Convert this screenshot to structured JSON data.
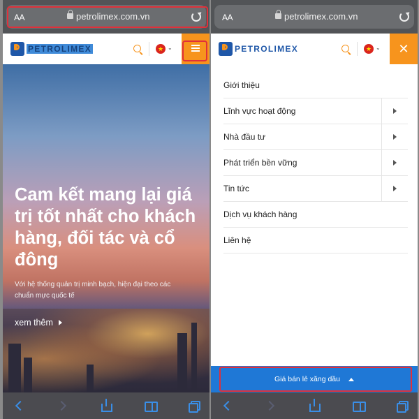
{
  "colors": {
    "brand_blue": "#1f57a8",
    "brand_orange": "#f7941d",
    "link_blue": "#3a8ee6",
    "highlight_red": "#e0303a",
    "price_bar_blue": "#1f78d6"
  },
  "browser": {
    "aa_label": "AA",
    "url": "petrolimex.com.vn"
  },
  "header": {
    "logo_text": "PETROLIMEX",
    "flag_glyph": "★",
    "chevron": "⌄",
    "close_glyph": "✕"
  },
  "hero": {
    "title": "Cam kết mang lại giá trị tốt nhất cho khách hàng, đối tác và cổ đông",
    "subtitle": "Với hệ thống quản trị minh bạch, hiện đại theo các chuẩn mực quốc tế",
    "cta": "xem thêm"
  },
  "menu": {
    "items": [
      {
        "label": "Giới thiệu",
        "has_submenu": false
      },
      {
        "label": "Lĩnh vực hoạt động",
        "has_submenu": true
      },
      {
        "label": "Nhà đầu tư",
        "has_submenu": true
      },
      {
        "label": "Phát triển bền vững",
        "has_submenu": true
      },
      {
        "label": "Tin tức",
        "has_submenu": true
      },
      {
        "label": "Dịch vụ khách hàng",
        "has_submenu": false
      },
      {
        "label": "Liên hệ",
        "has_submenu": false
      }
    ]
  },
  "price_bar": {
    "label": "Giá bán lẻ xăng dầu"
  },
  "toolbar_icons": [
    "back-icon",
    "forward-icon",
    "share-icon",
    "bookmarks-icon",
    "tabs-icon"
  ]
}
